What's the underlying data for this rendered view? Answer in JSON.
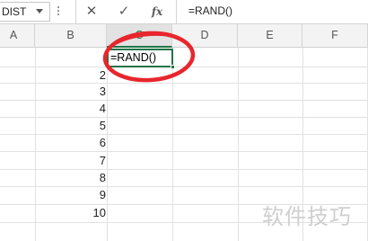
{
  "formula_bar": {
    "name_box": "DIST",
    "cancel_icon": "✕",
    "enter_icon": "✓",
    "fx_label": "fx",
    "formula": "=RAND()"
  },
  "columns": [
    "A",
    "B",
    "C",
    "D",
    "E",
    "F"
  ],
  "selected_column": "C",
  "column_b_values": [
    "2",
    "3",
    "4",
    "5",
    "6",
    "7",
    "8",
    "9",
    "10"
  ],
  "active_cell": {
    "column": "C",
    "content": "=RAND()"
  },
  "annotation": {
    "color": "#e8262d"
  },
  "watermark": "软件技巧",
  "colors": {
    "accent": "#217346",
    "annotation_red": "#e8262d"
  }
}
